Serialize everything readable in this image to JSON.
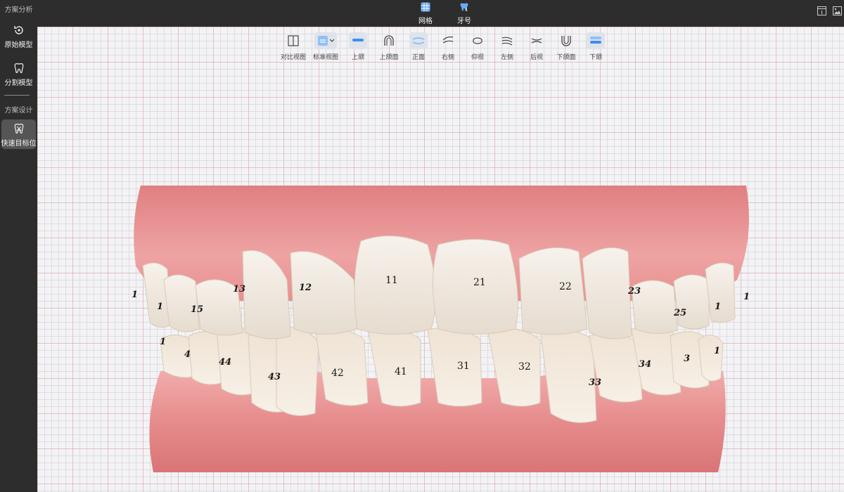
{
  "sidebar": {
    "section1_title": "方案分析",
    "items": [
      {
        "label": "原始模型",
        "icon": "rotate-model-icon"
      },
      {
        "label": "分割模型",
        "icon": "tooth-icon"
      }
    ],
    "section2_title": "方案设计",
    "design_items": [
      {
        "label": "快速目标位",
        "icon": "tooth-target-icon"
      }
    ]
  },
  "topbar": {
    "tabs": [
      {
        "label": "网格",
        "icon": "grid-icon"
      },
      {
        "label": "牙号",
        "icon": "tooth-number-icon"
      }
    ],
    "right_icons": [
      "info-panel-icon",
      "screenshot-icon"
    ]
  },
  "view_toolbar": {
    "buttons": [
      {
        "label": "对比视图",
        "icon": "compare-view-icon",
        "active": false
      },
      {
        "label": "标准视图",
        "icon": "standard-view-icon",
        "active": true
      },
      {
        "label": "上颌",
        "icon": "upper-jaw-icon",
        "active": true
      },
      {
        "label": "上颌面",
        "icon": "upper-occlusal-icon",
        "active": false
      },
      {
        "label": "正面",
        "icon": "front-view-icon",
        "active": true
      },
      {
        "label": "右侧",
        "icon": "right-view-icon",
        "active": false
      },
      {
        "label": "仰视",
        "icon": "bottom-view-icon",
        "active": false
      },
      {
        "label": "左侧",
        "icon": "left-view-icon",
        "active": false
      },
      {
        "label": "后视",
        "icon": "back-view-icon",
        "active": false
      },
      {
        "label": "下颌面",
        "icon": "lower-occlusal-icon",
        "active": false
      },
      {
        "label": "下颌",
        "icon": "lower-jaw-icon",
        "active": true
      }
    ]
  },
  "colors": {
    "accent": "#3d8ef0",
    "gum": "#e58a8c",
    "tooth": "#efe7df"
  },
  "teeth": {
    "upper": [
      "11",
      "21",
      "12",
      "22",
      "13",
      "23",
      "15",
      "25"
    ],
    "lower": [
      "41",
      "31",
      "42",
      "32",
      "43",
      "33",
      "44",
      "34"
    ],
    "partial_marks": [
      "1",
      "1",
      "1",
      "1",
      "1",
      "1",
      "4",
      "3",
      "1"
    ]
  }
}
